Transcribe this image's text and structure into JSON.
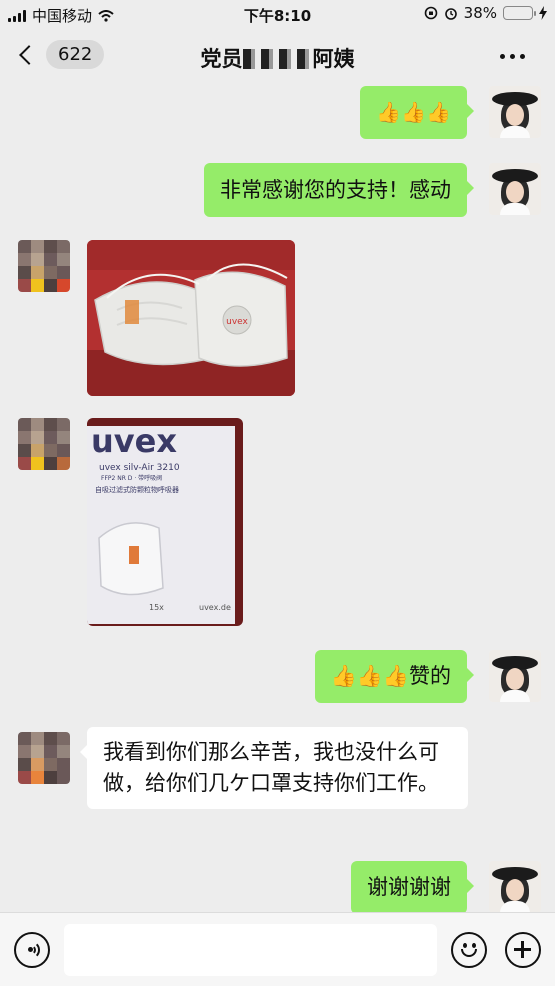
{
  "status_bar": {
    "carrier": "中国移动",
    "time": "下午8:10",
    "battery": "38%",
    "battery_level": 0.38
  },
  "nav": {
    "unread_count": "622",
    "title_prefix": "党员",
    "title_suffix": "阿姨"
  },
  "messages": [
    {
      "side": "me",
      "type": "text",
      "text": "👍👍👍"
    },
    {
      "side": "me",
      "type": "text",
      "text": "非常感谢您的支持！感动"
    },
    {
      "side": "them",
      "type": "image",
      "image_label": "uvex"
    },
    {
      "side": "them",
      "type": "image",
      "brand": "uvex",
      "product": "uvex silv-Air 3210",
      "spec": "FFP2 NR D · 带呼吸阀",
      "desc": "自吸过滤式防颗粒物呼吸器",
      "count": "15x",
      "site": "uvex.de"
    },
    {
      "side": "me",
      "type": "text",
      "text": "👍👍👍赞的"
    },
    {
      "side": "them",
      "type": "text",
      "text": "我看到你们那么辛苦，我也没什么可做，给你们几ケ口罩支持你们工作。"
    },
    {
      "side": "me",
      "type": "text",
      "text": "谢谢谢谢"
    }
  ],
  "icons": {
    "voice": "voice-icon",
    "emoji": "emoji-icon",
    "plus": "plus-icon",
    "back": "chevron-left-icon",
    "more": "more-icon"
  },
  "colors": {
    "bubble_mine": "#95ec69",
    "bubble_theirs": "#ffffff",
    "background": "#ededed",
    "battery": "#3ac34b"
  }
}
